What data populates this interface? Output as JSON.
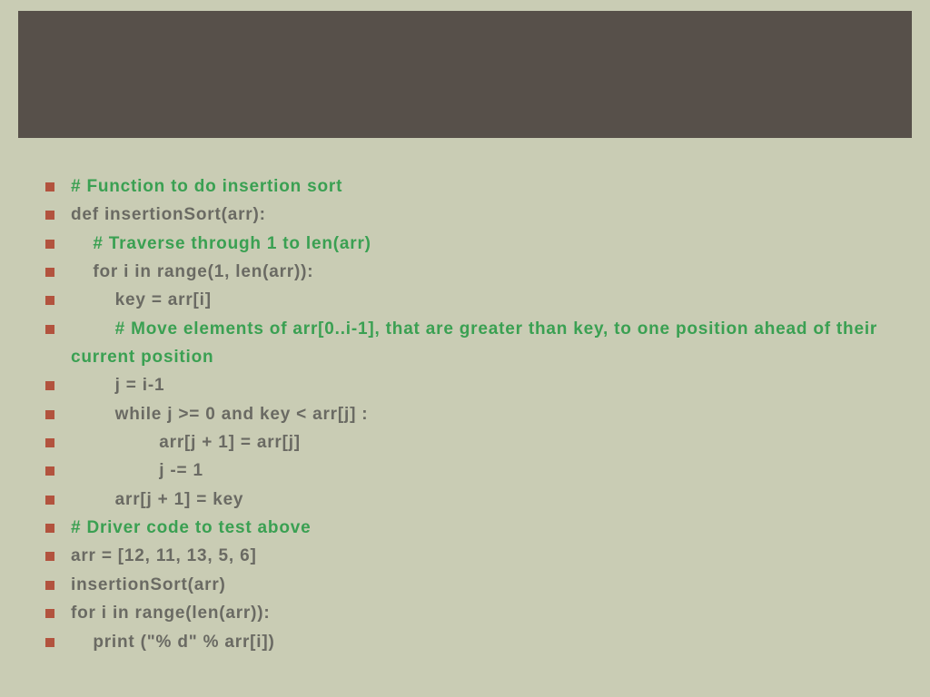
{
  "lines": [
    {
      "text": "# Function to do insertion sort",
      "class": "comment"
    },
    {
      "text": "def insertionSort(arr):",
      "class": "code"
    },
    {
      "text": "    # Traverse through 1 to len(arr)",
      "class": "comment"
    },
    {
      "text": "    for i in range(1, len(arr)):",
      "class": "code"
    },
    {
      "text": "        key = arr[i]",
      "class": "code"
    },
    {
      "text": "        # Move elements of arr[0..i-1], that are greater than key, to one position ahead of their current position",
      "class": "comment"
    },
    {
      "text": "        j = i-1",
      "class": "code"
    },
    {
      "text": "        while j >= 0 and key < arr[j] :",
      "class": "code"
    },
    {
      "text": "                arr[j + 1] = arr[j]",
      "class": "code"
    },
    {
      "text": "                j -= 1",
      "class": "code"
    },
    {
      "text": "        arr[j + 1] = key",
      "class": "code"
    },
    {
      "text": "# Driver code to test above",
      "class": "comment"
    },
    {
      "text": "arr = [12, 11, 13, 5, 6]",
      "class": "code"
    },
    {
      "text": "insertionSort(arr)",
      "class": "code"
    },
    {
      "text": "for i in range(len(arr)):",
      "class": "code"
    },
    {
      "text": "    print (\"% d\" % arr[i])",
      "class": "code"
    }
  ]
}
